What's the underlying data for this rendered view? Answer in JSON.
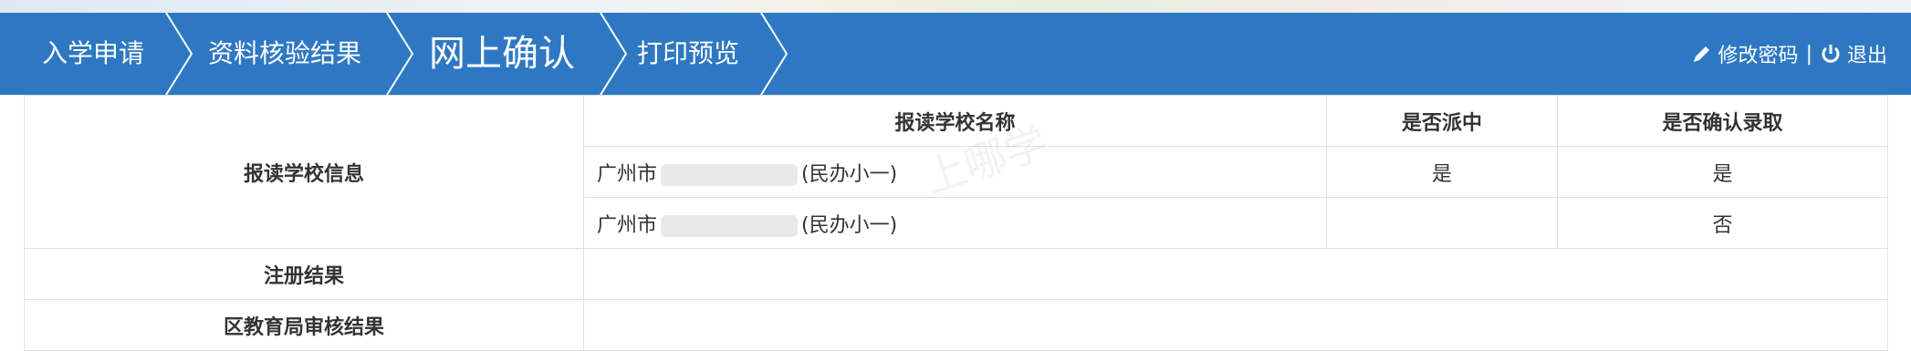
{
  "nav": {
    "crumbs": [
      "入学申请",
      "资料核验结果",
      "网上确认",
      "打印预览"
    ],
    "active_index": 2,
    "change_password": "修改密码",
    "separator": "|",
    "logout": "退出"
  },
  "table": {
    "header": {
      "school_name": "报读学校名称",
      "dispatched": "是否派中",
      "confirmed": "是否确认录取"
    },
    "school_info_label": "报读学校信息",
    "rows": [
      {
        "prefix": "广州市",
        "suffix": "(民办小一)",
        "dispatched": "是",
        "confirmed": "是"
      },
      {
        "prefix": "广州市",
        "suffix": "(民办小一)",
        "dispatched": "",
        "confirmed": "否"
      }
    ],
    "registration_label": "注册结果",
    "review_label": "区教育局审核结果"
  },
  "watermark": "上哪学",
  "colors": {
    "nav_bg": "#2e78c3",
    "border": "#e1e1e1"
  }
}
